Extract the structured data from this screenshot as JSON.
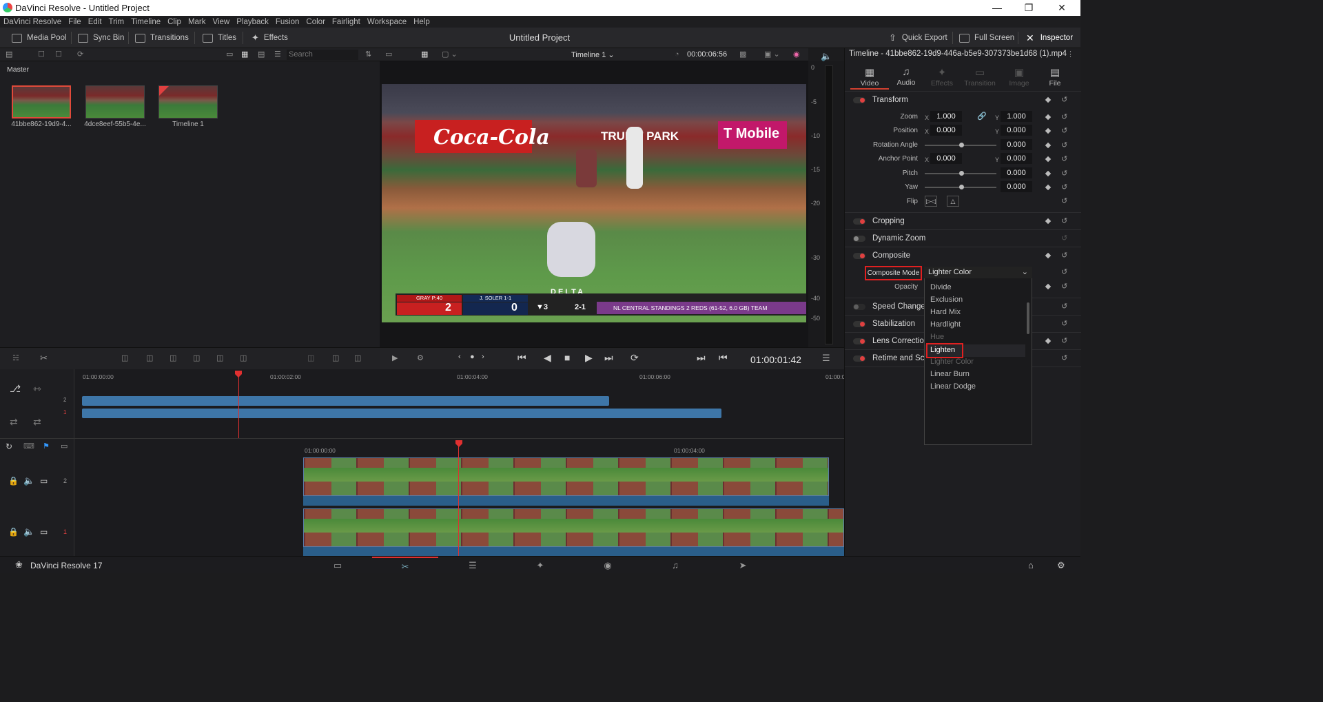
{
  "window": {
    "title": "DaVinci Resolve - Untitled Project",
    "minimize_icon": "minimize-icon",
    "restore_icon": "restore-icon",
    "close_icon": "close-icon"
  },
  "menu": [
    "DaVinci Resolve",
    "File",
    "Edit",
    "Trim",
    "Timeline",
    "Clip",
    "Mark",
    "View",
    "Playback",
    "Fusion",
    "Color",
    "Fairlight",
    "Workspace",
    "Help"
  ],
  "toolbar": {
    "media_pool": "Media Pool",
    "sync_bin": "Sync Bin",
    "transitions": "Transitions",
    "titles": "Titles",
    "effects": "Effects",
    "project_title": "Untitled Project",
    "quick_export": "Quick Export",
    "full_screen": "Full Screen",
    "inspector": "Inspector"
  },
  "media_pool": {
    "search_placeholder": "Search",
    "bin": "Master",
    "clips": [
      {
        "label": "41bbe862-19d9-4...",
        "selected": true
      },
      {
        "label": "4dce8eef-55b5-4e...",
        "selected": false
      },
      {
        "label": "Timeline 1",
        "selected": false
      }
    ]
  },
  "viewer": {
    "timeline_name": "Timeline 1",
    "duration": "00:00:06:56",
    "timecode": "01:00:01:42",
    "video": {
      "ads": [
        "Coca-Cola",
        "TRUIST PARK",
        "T Mobile",
        "DELTA"
      ],
      "score": {
        "away_pitcher": "GRAY P:40",
        "away_score": "2",
        "batter": "J. SOLER 1-1",
        "home_score": "0",
        "inning": "▼3",
        "count": "2-1",
        "ticker": "NL CENTRAL STANDINGS  2 REDS (61-52, 6.0 GB)  TEAM"
      }
    },
    "meter_ticks": [
      "0",
      "-5",
      "-10",
      "-15",
      "-20",
      "-30",
      "-40",
      "-50"
    ]
  },
  "timeline": {
    "mini_ruler": [
      "01:00:00:00",
      "01:00:02:00",
      "01:00:04:00",
      "01:00:06:00",
      "01:00:0"
    ],
    "big_ruler": [
      "01:00:00:00",
      "01:00:04:00"
    ],
    "tracks": [
      "2",
      "1"
    ]
  },
  "inspector": {
    "title": "Timeline - 41bbe862-19d9-446a-b5e9-307373be1d68 (1).mp4",
    "tabs": [
      {
        "label": "Video",
        "active": true,
        "icon": "video-icon"
      },
      {
        "label": "Audio",
        "active": false,
        "icon": "music-icon"
      },
      {
        "label": "Effects",
        "active": false,
        "icon": "effects-icon"
      },
      {
        "label": "Transition",
        "active": false,
        "icon": "transition-icon"
      },
      {
        "label": "Image",
        "active": false,
        "icon": "image-icon"
      },
      {
        "label": "File",
        "active": false,
        "icon": "file-icon"
      }
    ],
    "sections": {
      "transform": "Transform",
      "cropping": "Cropping",
      "dynamic_zoom": "Dynamic Zoom",
      "composite": "Composite",
      "speed_change": "Speed Change",
      "stabilization": "Stabilization",
      "lens_correction": "Lens Correction",
      "retime": "Retime and Sca"
    },
    "transform": {
      "zoom_label": "Zoom",
      "zoom_x": "1.000",
      "zoom_y": "1.000",
      "position_label": "Position",
      "position_x": "0.000",
      "position_y": "0.000",
      "rotation_label": "Rotation Angle",
      "rotation": "0.000",
      "anchor_label": "Anchor Point",
      "anchor_x": "0.000",
      "anchor_y": "0.000",
      "pitch_label": "Pitch",
      "pitch": "0.000",
      "yaw_label": "Yaw",
      "yaw": "0.000",
      "flip_label": "Flip",
      "x": "X",
      "y": "Y"
    },
    "composite": {
      "mode_label": "Composite Mode",
      "mode_value": "Lighter Color",
      "opacity_label": "Opacity",
      "options": [
        "Divide",
        "Exclusion",
        "Hard Mix",
        "Hardlight",
        "Hue",
        "Lighten",
        "Lighter Color",
        "Linear Burn",
        "Linear Dodge"
      ],
      "highlighted": "Lighten"
    }
  },
  "status": {
    "app": "DaVinci Resolve 17"
  },
  "colors": {
    "accent": "#e03030",
    "clip_blue": "#3e76a8",
    "highlight_box": "#e02020"
  }
}
